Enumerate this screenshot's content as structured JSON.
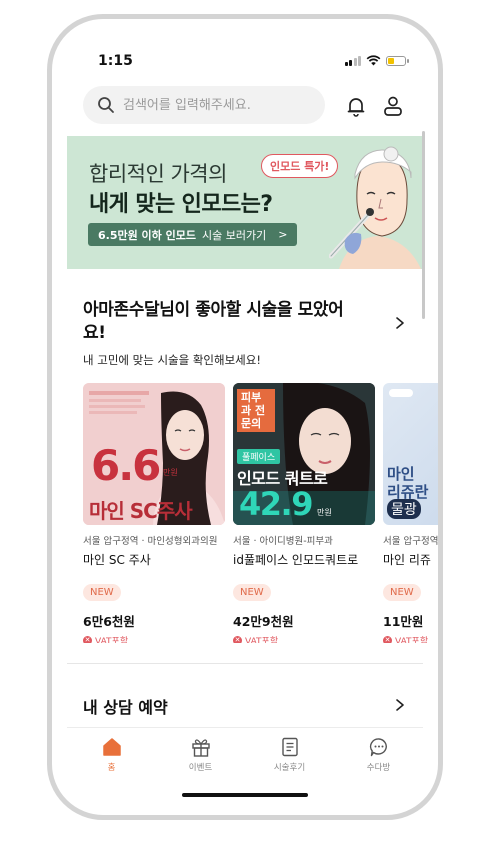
{
  "status_bar": {
    "time": "1:15"
  },
  "search": {
    "placeholder": "검색어를 입력해주세요."
  },
  "banner": {
    "line1": "합리적인 가격의",
    "line2": "내게 맞는 인모드는?",
    "badge": "인모드 특가!",
    "cta_bold": "6.5만원 이하 인모드",
    "cta_rest": "시술 보러가기",
    "cta_arrow": ">",
    "bg_color": "#cde6d4"
  },
  "recommend": {
    "title": "아마존수달님이 좋아할 시술을 모았어요!",
    "subtitle": "내 고민에 맞는 시술을 확인해보세요!",
    "cards": [
      {
        "meta": "서울 압구정역 · 마인성형외과의원",
        "name": "마인 SC 주사",
        "badge": "NEW",
        "price": "6만6천원",
        "vat": "VAT포함",
        "img_big": "6.6",
        "img_unit": "만원",
        "img_product": "마인 SC주사"
      },
      {
        "meta": "서울 · 아이디병원-피부과",
        "name": "id풀페이스 인모드쿼트로",
        "badge": "NEW",
        "price": "42만9천원",
        "vat": "VAT포함",
        "img_tag": "피부과 전문의",
        "img_pill": "풀페이스",
        "img_product": "인모드 쿼트로",
        "img_big": "42.9",
        "img_unit": "만원"
      },
      {
        "meta": "서울 압구정역",
        "name": "마인 리쥬",
        "badge": "NEW",
        "price": "11만원",
        "vat": "VAT포함",
        "img_product1": "마인",
        "img_product2": "리쥬란",
        "img_product3": "물광"
      }
    ]
  },
  "consult": {
    "title": "내 상담 예약"
  },
  "tabs": [
    {
      "label": "홈",
      "icon": "home-icon",
      "active": true
    },
    {
      "label": "이벤트",
      "icon": "gift-icon",
      "active": false
    },
    {
      "label": "시술후기",
      "icon": "document-icon",
      "active": false
    },
    {
      "label": "수다방",
      "icon": "chat-icon",
      "active": false
    }
  ],
  "colors": {
    "accent": "#e8703a",
    "vat_red": "#e0585f",
    "badge_bg": "#fde7e0"
  }
}
